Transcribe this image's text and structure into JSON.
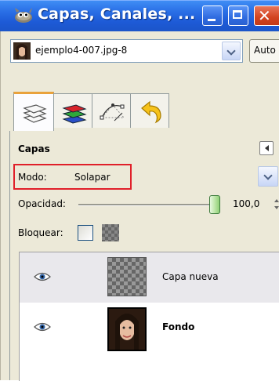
{
  "window": {
    "title": "Capas, Canales, ...",
    "icon": "gimp-wilber-icon",
    "controls": [
      "minimize-icon",
      "maximize-icon",
      "close-icon"
    ]
  },
  "image_selector": {
    "value": "ejemplo4-007.jpg-8",
    "auto_label": "Auto"
  },
  "tabs": [
    {
      "name": "layers",
      "icon": "layers-icon",
      "active": true
    },
    {
      "name": "channels",
      "icon": "channels-icon",
      "active": false
    },
    {
      "name": "paths",
      "icon": "paths-icon",
      "active": false
    },
    {
      "name": "undo-history",
      "icon": "undo-icon",
      "active": false
    }
  ],
  "panel": {
    "title": "Capas",
    "mode_label": "Modo:",
    "mode_value": "Solapar",
    "opacity_label": "Opacidad:",
    "opacity_value": "100,0",
    "opacity_fraction": 1.0,
    "lock_label": "Bloquear:"
  },
  "layers": [
    {
      "name": "Capa nueva",
      "visible": true,
      "selected": true,
      "thumbnail": "transparent-checker"
    },
    {
      "name": "Fondo",
      "visible": true,
      "selected": false,
      "thumbnail": "portrait-photo"
    }
  ],
  "colors": {
    "titlebar": "#2a6fe6",
    "highlight_box": "#e0202a",
    "panel_bg": "#ece9d8"
  }
}
